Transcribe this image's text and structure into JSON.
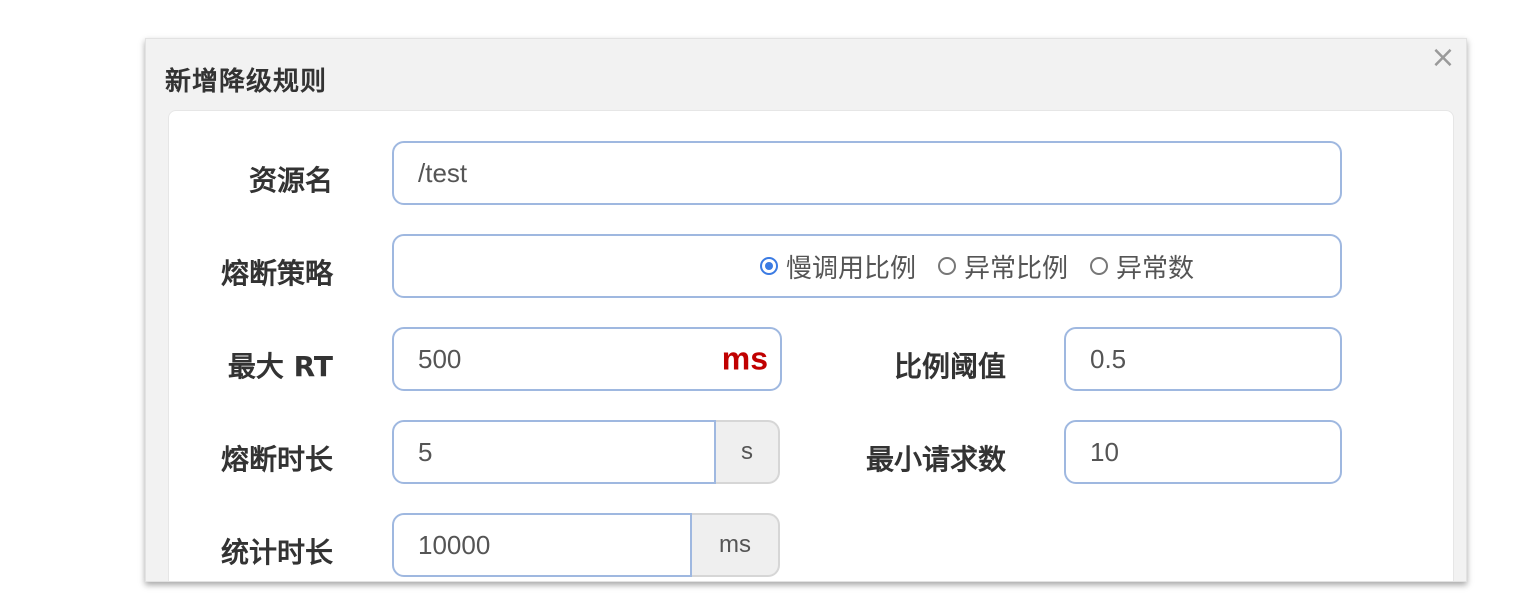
{
  "dialog": {
    "title": "新增降级规则",
    "close_glyph": "×"
  },
  "form": {
    "resource": {
      "label": "资源名",
      "value": "/test"
    },
    "strategy": {
      "label": "熔断策略",
      "options": [
        "慢调用比例",
        "异常比例",
        "异常数"
      ],
      "selected": "慢调用比例"
    },
    "max_rt": {
      "label": "最大 RT",
      "value": "500",
      "unit": "ms"
    },
    "ratio_threshold": {
      "label": "比例阈值",
      "value": "0.5"
    },
    "break_duration": {
      "label": "熔断时长",
      "value": "5",
      "unit": "s"
    },
    "min_requests": {
      "label": "最小请求数",
      "value": "10"
    },
    "stat_duration": {
      "label": "统计时长",
      "value": "10000",
      "unit": "ms"
    }
  },
  "colors": {
    "accent": "#3b7be3",
    "field_border": "#9fb8e0",
    "unit_red": "#c00000"
  },
  "icons": {
    "close": "close-icon",
    "radio": "radio-icon"
  }
}
